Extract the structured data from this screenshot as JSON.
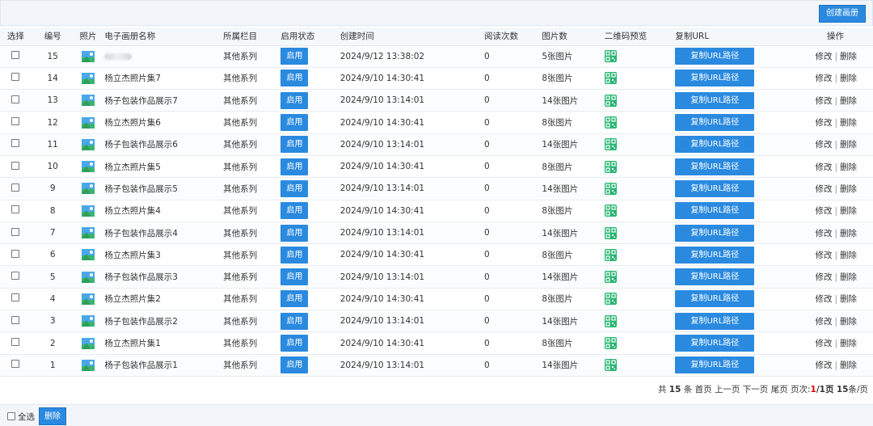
{
  "toolbar": {
    "create_label": "创建画册"
  },
  "table": {
    "headers": [
      "选择",
      "编号",
      "照片",
      "电子画册名称",
      "所属栏目",
      "启用状态",
      "创建时间",
      "阅读次数",
      "图片数",
      "二维码预览",
      "复制URL",
      "操作"
    ],
    "rows": [
      {
        "id": "15",
        "name": "",
        "column": "其他系列",
        "status": "启用",
        "time": "2024/9/12 13:38:02",
        "reads": "0",
        "pics": "5张图片",
        "url_label": "复制URL路径",
        "edit": "修改",
        "del": "删除"
      },
      {
        "id": "14",
        "name": "杨立杰照片集7",
        "column": "其他系列",
        "status": "启用",
        "time": "2024/9/10 14:30:41",
        "reads": "0",
        "pics": "8张图片",
        "url_label": "复制URL路径",
        "edit": "修改",
        "del": "删除"
      },
      {
        "id": "13",
        "name": "杨子包装作品展示7",
        "column": "其他系列",
        "status": "启用",
        "time": "2024/9/10 13:14:01",
        "reads": "0",
        "pics": "14张图片",
        "url_label": "复制URL路径",
        "edit": "修改",
        "del": "删除"
      },
      {
        "id": "12",
        "name": "杨立杰照片集6",
        "column": "其他系列",
        "status": "启用",
        "time": "2024/9/10 14:30:41",
        "reads": "0",
        "pics": "8张图片",
        "url_label": "复制URL路径",
        "edit": "修改",
        "del": "删除"
      },
      {
        "id": "11",
        "name": "杨子包装作品展示6",
        "column": "其他系列",
        "status": "启用",
        "time": "2024/9/10 13:14:01",
        "reads": "0",
        "pics": "14张图片",
        "url_label": "复制URL路径",
        "edit": "修改",
        "del": "删除"
      },
      {
        "id": "10",
        "name": "杨立杰照片集5",
        "column": "其他系列",
        "status": "启用",
        "time": "2024/9/10 14:30:41",
        "reads": "0",
        "pics": "8张图片",
        "url_label": "复制URL路径",
        "edit": "修改",
        "del": "删除"
      },
      {
        "id": "9",
        "name": "杨子包装作品展示5",
        "column": "其他系列",
        "status": "启用",
        "time": "2024/9/10 13:14:01",
        "reads": "0",
        "pics": "14张图片",
        "url_label": "复制URL路径",
        "edit": "修改",
        "del": "删除"
      },
      {
        "id": "8",
        "name": "杨立杰照片集4",
        "column": "其他系列",
        "status": "启用",
        "time": "2024/9/10 14:30:41",
        "reads": "0",
        "pics": "8张图片",
        "url_label": "复制URL路径",
        "edit": "修改",
        "del": "删除"
      },
      {
        "id": "7",
        "name": "杨子包装作品展示4",
        "column": "其他系列",
        "status": "启用",
        "time": "2024/9/10 13:14:01",
        "reads": "0",
        "pics": "14张图片",
        "url_label": "复制URL路径",
        "edit": "修改",
        "del": "删除"
      },
      {
        "id": "6",
        "name": "杨立杰照片集3",
        "column": "其他系列",
        "status": "启用",
        "time": "2024/9/10 14:30:41",
        "reads": "0",
        "pics": "8张图片",
        "url_label": "复制URL路径",
        "edit": "修改",
        "del": "删除"
      },
      {
        "id": "5",
        "name": "杨子包装作品展示3",
        "column": "其他系列",
        "status": "启用",
        "time": "2024/9/10 13:14:01",
        "reads": "0",
        "pics": "14张图片",
        "url_label": "复制URL路径",
        "edit": "修改",
        "del": "删除"
      },
      {
        "id": "4",
        "name": "杨立杰照片集2",
        "column": "其他系列",
        "status": "启用",
        "time": "2024/9/10 14:30:41",
        "reads": "0",
        "pics": "8张图片",
        "url_label": "复制URL路径",
        "edit": "修改",
        "del": "删除"
      },
      {
        "id": "3",
        "name": "杨子包装作品展示2",
        "column": "其他系列",
        "status": "启用",
        "time": "2024/9/10 13:14:01",
        "reads": "0",
        "pics": "14张图片",
        "url_label": "复制URL路径",
        "edit": "修改",
        "del": "删除"
      },
      {
        "id": "2",
        "name": "杨立杰照片集1",
        "column": "其他系列",
        "status": "启用",
        "time": "2024/9/10 14:30:41",
        "reads": "0",
        "pics": "8张图片",
        "url_label": "复制URL路径",
        "edit": "修改",
        "del": "删除"
      },
      {
        "id": "1",
        "name": "杨子包装作品展示1",
        "column": "其他系列",
        "status": "启用",
        "time": "2024/9/10 13:14:01",
        "reads": "0",
        "pics": "14张图片",
        "url_label": "复制URL路径",
        "edit": "修改",
        "del": "删除"
      }
    ]
  },
  "pager": {
    "total_prefix": "共",
    "total": "15",
    "total_suffix": "条",
    "first": "首页",
    "prev": "上一页",
    "next": "下一页",
    "last": "尾页",
    "page_label": "页次:",
    "current": "1",
    "pages": "/1页",
    "per_page": "15",
    "per_page_suffix": "条/页"
  },
  "footer": {
    "select_all": "全选",
    "delete_label": "删除"
  },
  "icons": {
    "photo": "image-icon",
    "qr": "qr-code-icon"
  },
  "colors": {
    "accent": "#2a8ae0",
    "qr": "#2bb673",
    "pager_current": "#dd0000"
  }
}
